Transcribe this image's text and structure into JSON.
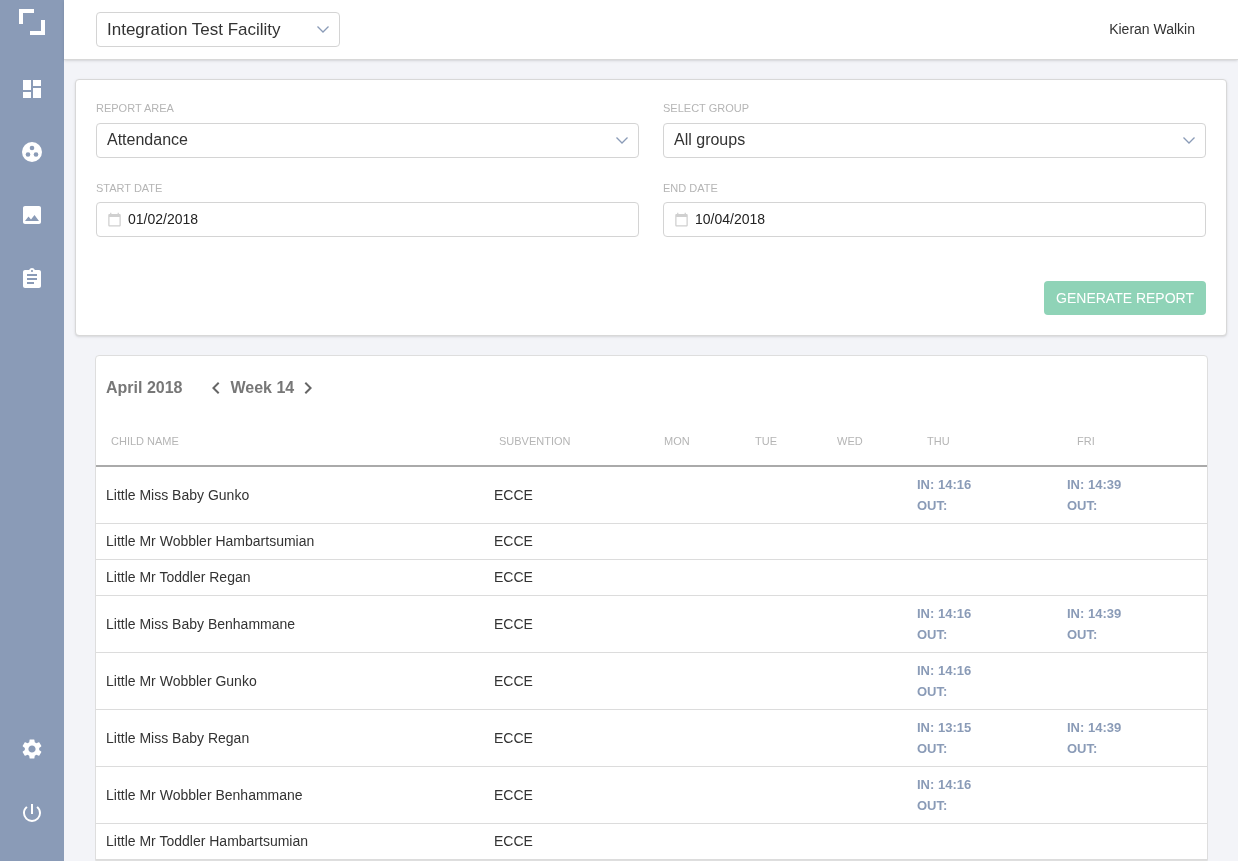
{
  "header": {
    "facility": "Integration Test Facility",
    "user": "Kieran Walkin"
  },
  "filters": {
    "report_area": {
      "label": "REPORT AREA",
      "value": "Attendance"
    },
    "select_group": {
      "label": "SELECT GROUP",
      "value": "All groups"
    },
    "start_date": {
      "label": "START DATE",
      "value": "01/02/2018"
    },
    "end_date": {
      "label": "END DATE",
      "value": "10/04/2018"
    },
    "generate_button": {
      "label": "GENERATE REPORT",
      "disabled": true
    }
  },
  "report": {
    "month": "April 2018",
    "week": "Week 14",
    "columns": [
      "CHILD NAME",
      "SUBVENTION",
      "MON",
      "TUE",
      "WED",
      "THU",
      "FRI"
    ],
    "rows": [
      {
        "name": "Little Miss Baby Gunko",
        "subvention": "ECCE",
        "thu": {
          "in": "IN: 14:16",
          "out": "OUT:"
        },
        "fri": {
          "in": "IN: 14:39",
          "out": "OUT:"
        }
      },
      {
        "name": "Little Mr Wobbler Hambartsumian",
        "subvention": "ECCE"
      },
      {
        "name": "Little Mr Toddler Regan",
        "subvention": "ECCE"
      },
      {
        "name": "Little Miss Baby Benhammane",
        "subvention": "ECCE",
        "thu": {
          "in": "IN: 14:16",
          "out": "OUT:"
        },
        "fri": {
          "in": "IN: 14:39",
          "out": "OUT:"
        }
      },
      {
        "name": "Little Mr Wobbler Gunko",
        "subvention": "ECCE",
        "thu": {
          "in": "IN: 14:16",
          "out": "OUT:"
        }
      },
      {
        "name": "Little Miss Baby Regan",
        "subvention": "ECCE",
        "thu": {
          "in": "IN: 13:15",
          "out": "OUT:"
        },
        "fri": {
          "in": "IN: 14:39",
          "out": "OUT:"
        }
      },
      {
        "name": "Little Mr Wobbler Benhammane",
        "subvention": "ECCE",
        "thu": {
          "in": "IN: 14:16",
          "out": "OUT:"
        }
      },
      {
        "name": "Little Mr Toddler Hambartsumian",
        "subvention": "ECCE"
      }
    ]
  }
}
